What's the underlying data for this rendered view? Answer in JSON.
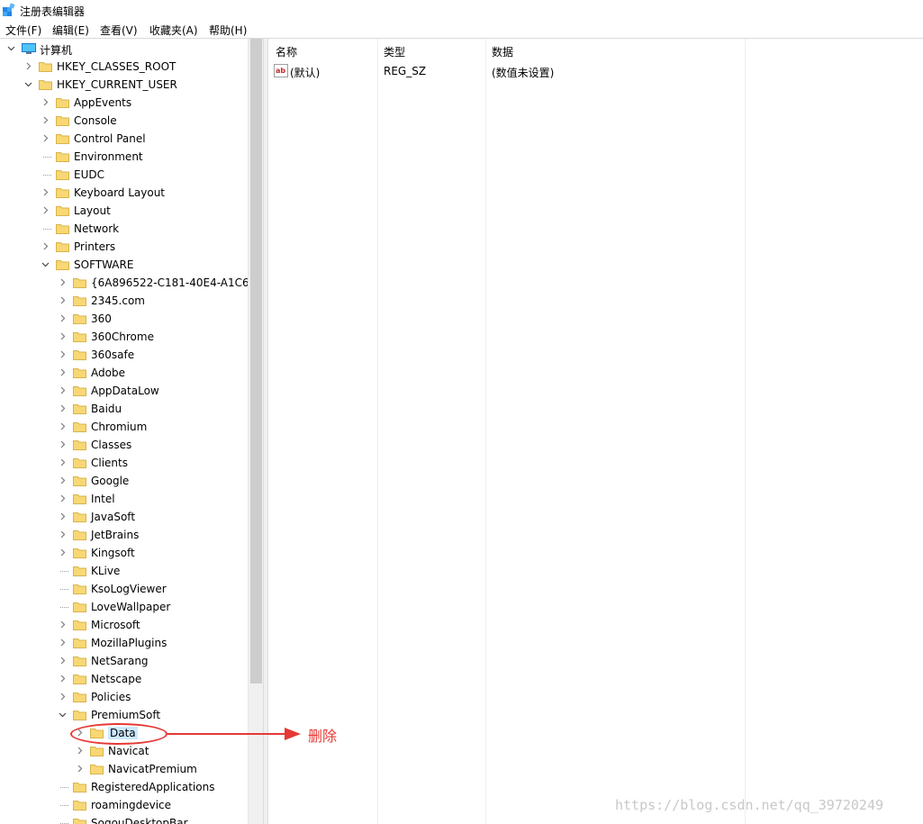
{
  "window": {
    "title": "注册表编辑器"
  },
  "menu": [
    "文件(F)",
    "编辑(E)",
    "查看(V)",
    "收藏夹(A)",
    "帮助(H)"
  ],
  "tree": {
    "root": "计算机",
    "hives": [
      "HKEY_CLASSES_ROOT",
      "HKEY_CURRENT_USER"
    ],
    "current_user_keys": [
      "AppEvents",
      "Console",
      "Control Panel",
      "Environment",
      "EUDC",
      "Keyboard Layout",
      "Layout",
      "Network",
      "Printers",
      "SOFTWARE"
    ],
    "software_keys": [
      "{6A896522-C181-40E4-A1C6-C",
      "2345.com",
      "360",
      "360Chrome",
      "360safe",
      "Adobe",
      "AppDataLow",
      "Baidu",
      "Chromium",
      "Classes",
      "Clients",
      "Google",
      "Intel",
      "JavaSoft",
      "JetBrains",
      "Kingsoft",
      "KLive",
      "KsoLogViewer",
      "LoveWallpaper",
      "Microsoft",
      "MozillaPlugins",
      "NetSarang",
      "Netscape",
      "Policies",
      "PremiumSoft"
    ],
    "premiumsoft_keys": [
      "Data",
      "Navicat",
      "NavicatPremium"
    ],
    "after_keys": [
      "RegisteredApplications",
      "roamingdevice",
      "SogouDesktopBar"
    ]
  },
  "list": {
    "columns": [
      "名称",
      "类型",
      "数据"
    ],
    "rows": [
      {
        "name": "(默认)",
        "type": "REG_SZ",
        "data": "(数值未设置)"
      }
    ]
  },
  "annotation": {
    "text": "删除"
  },
  "watermark": "https://blog.csdn.net/qq_39720249",
  "colors": {
    "annotation": "#e53935",
    "folder": "#f8d775",
    "selection": "#cce8ff"
  }
}
